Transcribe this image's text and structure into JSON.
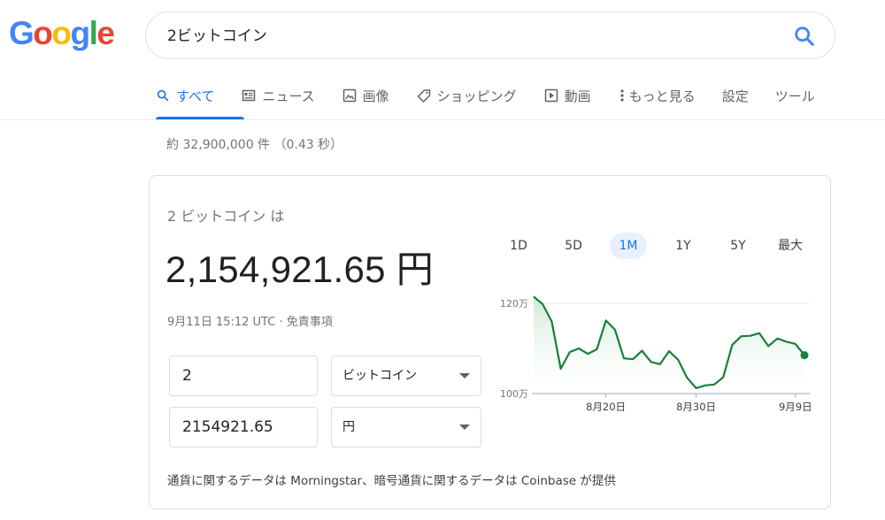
{
  "logo": {
    "letters": [
      "G",
      "o",
      "o",
      "g",
      "l",
      "e"
    ],
    "colors": [
      "#4285F4",
      "#EA4335",
      "#FBBC05",
      "#4285F4",
      "#34A853",
      "#EA4335"
    ]
  },
  "search": {
    "query": "2ビットコイン",
    "icon": "search-icon"
  },
  "tabs": [
    {
      "label": "すべて",
      "icon": "search-icon",
      "active": true
    },
    {
      "label": "ニュース",
      "icon": "news-icon"
    },
    {
      "label": "画像",
      "icon": "image-icon"
    },
    {
      "label": "ショッピング",
      "icon": "tag-icon"
    },
    {
      "label": "動画",
      "icon": "play-icon"
    },
    {
      "label": "もっと見る",
      "icon": "more-vert-icon"
    },
    {
      "label": "設定"
    },
    {
      "label": "ツール"
    }
  ],
  "result_stats": "約 32,900,000 件 （0.43 秒）",
  "card": {
    "label": "2 ビットコイン は",
    "value": "2,154,921.65 円",
    "timestamp": "9月11日 15:12 UTC",
    "separator": " · ",
    "disclaimer": "免責事項",
    "from_amount": "2",
    "from_currency": "ビットコイン",
    "to_amount": "2154921.65",
    "to_currency": "円",
    "source": "通貨に関するデータは Morningstar、暗号通貨に関するデータは Coinbase が提供"
  },
  "ranges": [
    "1D",
    "5D",
    "1M",
    "1Y",
    "5Y",
    "最大"
  ],
  "active_range": "1M",
  "chart_data": {
    "type": "area",
    "y_unit_labels": [
      "120万",
      "100万"
    ],
    "y_ticks": [
      1200000,
      1000000
    ],
    "ylim": [
      1000000,
      1200000
    ],
    "x_ticks": [
      "8月20日",
      "8月30日",
      "9月9日"
    ],
    "line_color": "#188038",
    "fill_color": "#e6f4ea",
    "values": [
      1215000,
      1198000,
      1160000,
      1055000,
      1092000,
      1100000,
      1088000,
      1098000,
      1162000,
      1142000,
      1078000,
      1076000,
      1095000,
      1070000,
      1065000,
      1094000,
      1075000,
      1035000,
      1012000,
      1018000,
      1020000,
      1036000,
      1108000,
      1127000,
      1128000,
      1134000,
      1105000,
      1122000,
      1115000,
      1110000,
      1085000
    ]
  }
}
